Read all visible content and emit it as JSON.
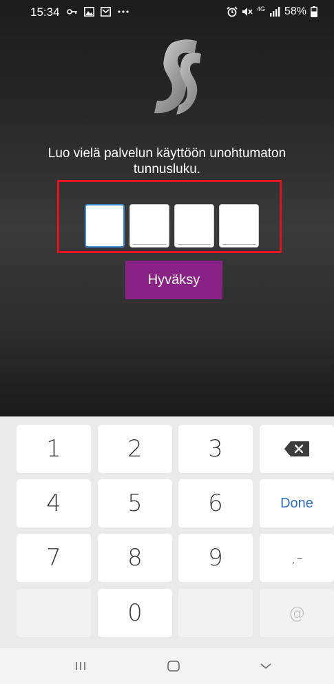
{
  "status_bar": {
    "time": "15:34",
    "battery": "58%",
    "network": "4G"
  },
  "prompt": {
    "text": "Luo vielä palvelun käyttöön unohtumaton tunnusluku."
  },
  "pin": {
    "digits": [
      "",
      "",
      "",
      ""
    ],
    "focused_index": 0
  },
  "accept_button": {
    "label": "Hyväksy"
  },
  "keyboard": {
    "keys": {
      "k1": "1",
      "k2": "2",
      "k3": "3",
      "k4": "4",
      "k5": "5",
      "k6": "6",
      "k7": "7",
      "k8": "8",
      "k9": "9",
      "k0": "0",
      "done": "Done",
      "symbols": ".-",
      "at": "@"
    }
  },
  "colors": {
    "accent": "#8a2186",
    "highlight": "#e0141a",
    "focus": "#3a8ad6",
    "done_text": "#2c6ec7"
  }
}
